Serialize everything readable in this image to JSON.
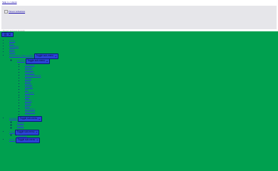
{
  "skip_link": "Skip to content",
  "header": {
    "logo_text": "Flower Adventure",
    "tagline": "Flower and trees blossom"
  },
  "nav": {
    "toggle_icons": "☰ ✕",
    "submenu_toggle_label": "Toggle sub-menu",
    "top_items": [
      "Home",
      "Blog",
      "Shopping",
      "Trees",
      "Plants"
    ],
    "group1": {
      "label": "Cultivation, Tips, Guides",
      "sub_label": "Flowers",
      "children": [
        "Anemone",
        "Astilbe",
        "Bluebell",
        "Carnation",
        "Chrysanthemum",
        "Dahlia",
        "Daisy",
        "Freesia",
        "Gerbera",
        "Iris",
        "Lavender",
        "Lilac",
        "Lily",
        "Orchid",
        "Peony",
        "Rose",
        "Snowdrop",
        "Sunflower",
        "Tulip"
      ]
    },
    "group2": {
      "label": "Gardens",
      "children": [
        "Bonsai",
        "Cactus",
        "Orchid"
      ]
    },
    "group3": {
      "label": "Trees",
      "children": [
        "Fruit trees"
      ]
    },
    "group4": {
      "label": "Plants"
    }
  }
}
